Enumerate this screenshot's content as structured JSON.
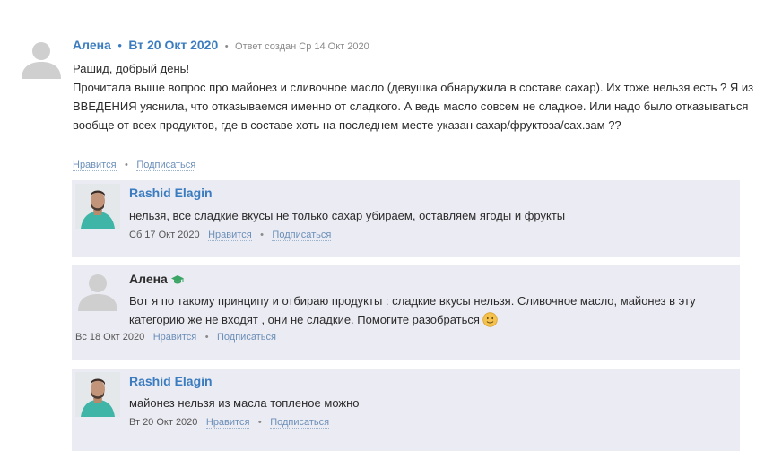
{
  "question": {
    "author": "Алена",
    "separator": "•",
    "date": "Вт 20 Окт 2020",
    "created": "Ответ создан Ср 14 Окт 2020",
    "lines": [
      "Рашид, добрый день!",
      "Прочитала выше вопрос про майонез и сливочное масло (девушка обнаружила в составе сахар). Их тоже нельзя есть ? Я из ВВЕДЕНИЯ уяснила, что отказываемся именно от сладкого. А ведь масло совсем не сладкое. Или надо было отказываться вообще от всех продуктов, где в составе хоть на последнем месте указан сахар/фруктоза/сах.зам ??"
    ],
    "like_label": "Нравится",
    "subscribe_label": "Подписаться",
    "dot": "•"
  },
  "replies": [
    {
      "author": "Rashid Elagin",
      "text": "нельзя, все сладкие вкусы не только сахар убираем, оставляем ягоды и фрукты",
      "date": "Сб 17 Окт 2020",
      "like_label": "Нравится",
      "subscribe_label": "Подписаться",
      "dot": "•"
    },
    {
      "author": "Алена",
      "text": "Вот я по такому принципу и отбираю продукты : сладкие вкусы нельзя. Сливочное масло, майонез в эту категорию же не входят , они не сладкие. Помогите разобраться",
      "date": "Вс 18 Окт 2020",
      "like_label": "Нравится",
      "subscribe_label": "Подписаться",
      "dot": "•"
    },
    {
      "author": "Rashid Elagin",
      "text": "майонез нельзя из масла топленое можно",
      "date": "Вт 20 Окт 2020",
      "like_label": "Нравится",
      "subscribe_label": "Подписаться",
      "dot": "•"
    }
  ],
  "icons": {
    "default_avatar": "user-silhouette-icon",
    "graduate": "graduation-cap-icon",
    "smile": "smiling-face-icon"
  },
  "colors": {
    "link": "#3a7cbf",
    "reply_bg": "#ebebf3",
    "graduate_icon": "#3aa564"
  }
}
